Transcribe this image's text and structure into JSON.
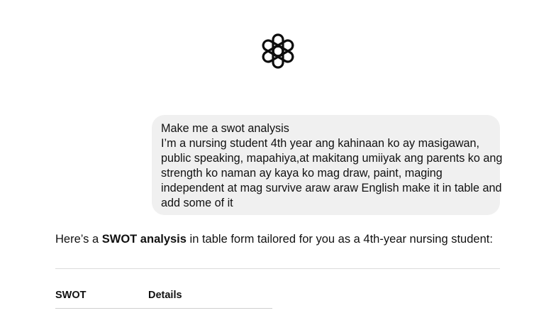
{
  "logo": {
    "icon": "openai-logo-icon"
  },
  "user_message": {
    "lines": [
      "Make me a swot analysis",
      "I’m a nursing student 4th year ang kahinaan ko ay masigawan,",
      "public speaking, mapahiya,at makitang umiiyak ang parents ko ang",
      "strength ko naman ay kaya ko mag draw, paint, maging",
      "independent at mag survive araw araw English make it in table and",
      "add some of it"
    ]
  },
  "assistant": {
    "intro_before": "Here’s a ",
    "intro_bold": "SWOT analysis",
    "intro_after": " in table form tailored for you as a 4th-year nursing student:",
    "table": {
      "columns": [
        "SWOT",
        "Details"
      ]
    }
  }
}
